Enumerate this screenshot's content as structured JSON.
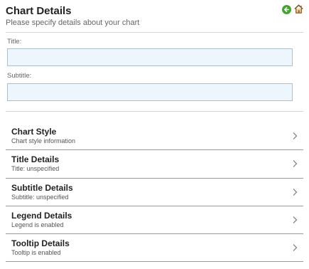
{
  "header": {
    "title": "Chart Details",
    "subtitle": "Please specify details about your chart"
  },
  "form": {
    "title_label": "Title:",
    "title_value": "",
    "subtitle_label": "Subtitle:",
    "subtitle_value": ""
  },
  "nav": {
    "items": [
      {
        "title": "Chart Style",
        "desc": "Chart style information"
      },
      {
        "title": "Title Details",
        "desc": "Title: unspecified"
      },
      {
        "title": "Subtitle Details",
        "desc": "Subtitle: unspecified"
      },
      {
        "title": "Legend Details",
        "desc": "Legend is enabled"
      },
      {
        "title": "Tooltip Details",
        "desc": "Tooltip is enabled"
      }
    ]
  },
  "icons": {
    "back": "back-arrow-icon",
    "home": "home-icon",
    "chevron": "chevron-right-icon"
  },
  "colors": {
    "back_button": "#45a32f",
    "input_bg": "#eef6fd",
    "input_border": "#aebfcc",
    "divider": "#d6d6d6",
    "row_border": "#9a9a9a"
  }
}
